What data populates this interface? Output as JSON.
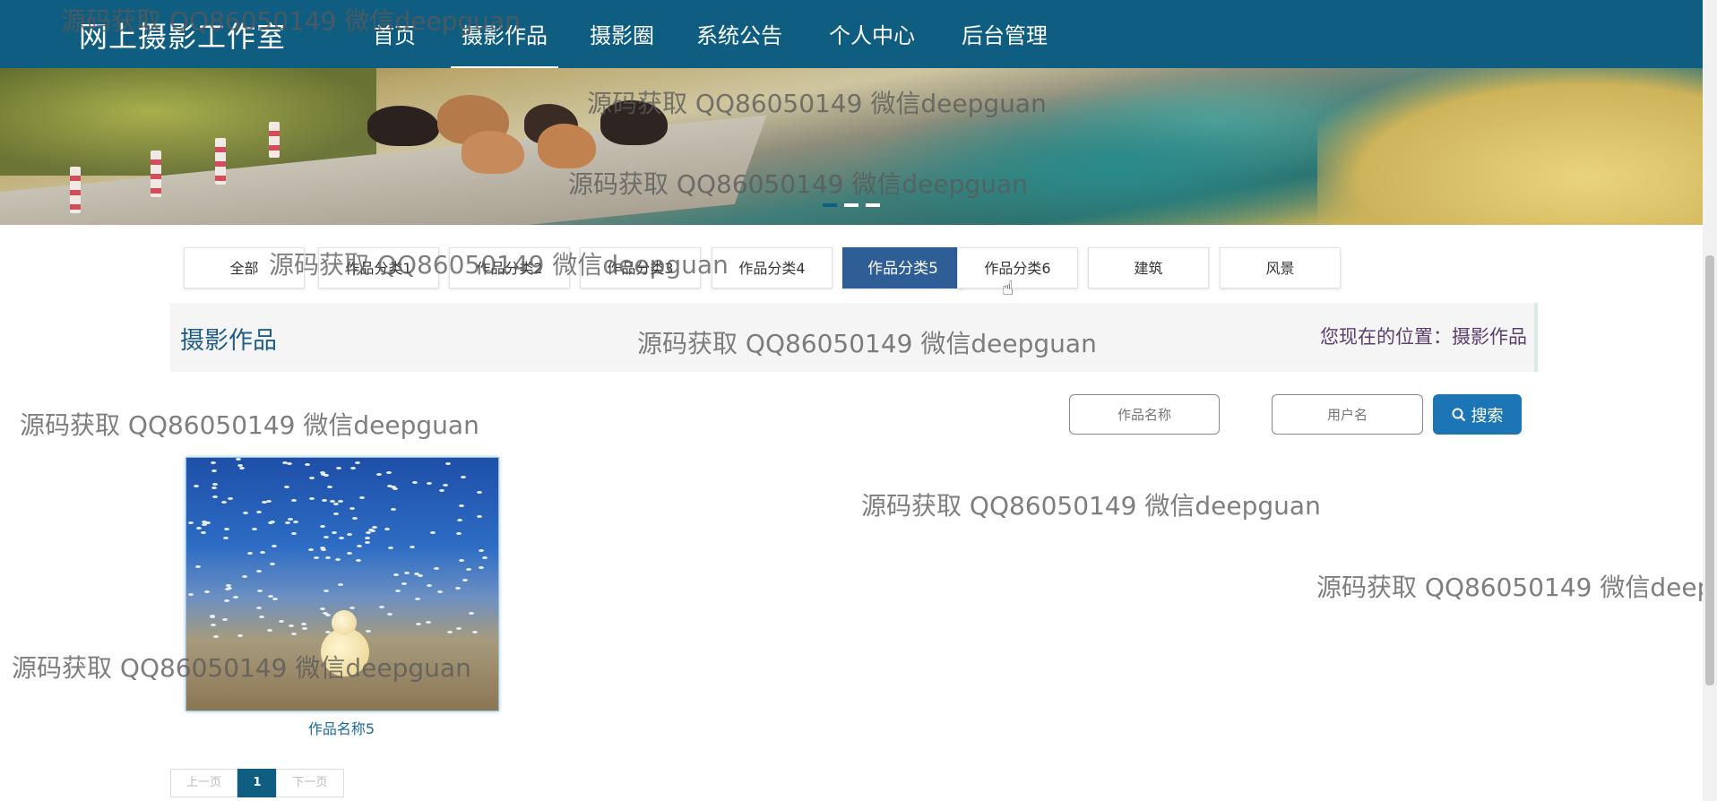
{
  "nav": {
    "brand": "网上摄影工作室",
    "items": [
      {
        "label": "首页"
      },
      {
        "label": "摄影作品"
      },
      {
        "label": "摄影圈"
      },
      {
        "label": "系统公告"
      },
      {
        "label": "个人中心"
      },
      {
        "label": "后台管理"
      }
    ],
    "active_index": 1
  },
  "categories": [
    {
      "label": "全部"
    },
    {
      "label": "作品分类1"
    },
    {
      "label": "作品分类2"
    },
    {
      "label": "作品分类3"
    },
    {
      "label": "作品分类4"
    },
    {
      "label": "作品分类5"
    },
    {
      "label": "作品分类6"
    },
    {
      "label": "建筑"
    },
    {
      "label": "风景"
    }
  ],
  "active_category_index": 5,
  "section": {
    "title": "摄影作品",
    "breadcrumb": "您现在的位置：摄影作品"
  },
  "search": {
    "name_placeholder": "作品名称",
    "user_placeholder": "用户名",
    "button_label": "搜索"
  },
  "works": [
    {
      "title": "作品名称5"
    }
  ],
  "pagination": {
    "prev": "上一页",
    "current": "1",
    "next": "下一页"
  },
  "watermark": "源码获取 QQ86050149 微信deepguan",
  "colors": {
    "nav_bg": "#0f5d80",
    "active_tab": "#2f5d96",
    "search_button": "#1c75b4",
    "title": "#1f5f86"
  }
}
